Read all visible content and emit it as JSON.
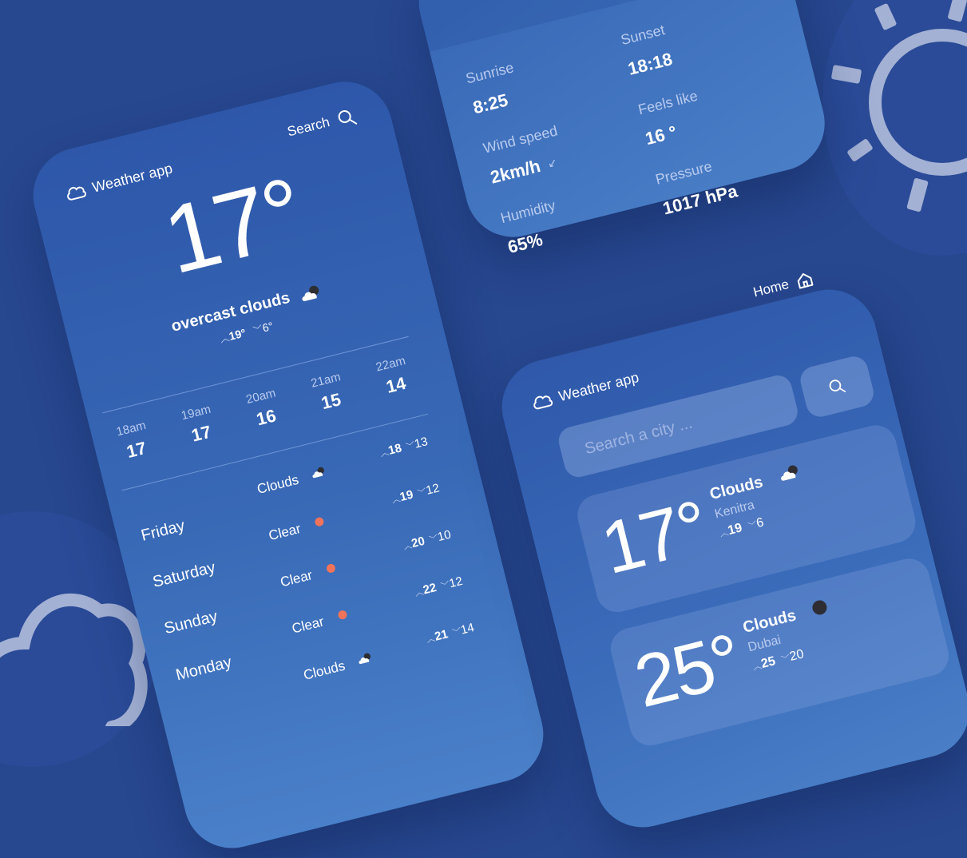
{
  "main": {
    "brand": "Weather app",
    "search_label": "Search",
    "temp": "17°",
    "condition": "overcast clouds",
    "high": "19°",
    "low": "6°",
    "hourly": [
      {
        "time": "18am",
        "temp": "17"
      },
      {
        "time": "19am",
        "temp": "17"
      },
      {
        "time": "20am",
        "temp": "16"
      },
      {
        "time": "21am",
        "temp": "15"
      },
      {
        "time": "22am",
        "temp": "14"
      }
    ],
    "daily": [
      {
        "day": "Friday",
        "condition": "Clouds",
        "icon": "cloud-sun-icon",
        "high": "18",
        "low": "13"
      },
      {
        "day": "Saturday",
        "condition": "Clear",
        "icon": "sun-dot-icon",
        "high": "19",
        "low": "12"
      },
      {
        "day": "Sunday",
        "condition": "Clear",
        "icon": "sun-dot-icon",
        "high": "20",
        "low": "10"
      },
      {
        "day": "Monday",
        "condition": "Clear",
        "icon": "sun-dot-icon",
        "high": "22",
        "low": "12"
      },
      {
        "day": "",
        "condition": "Clouds",
        "icon": "cloud-sun-icon",
        "high": "21",
        "low": "14"
      }
    ]
  },
  "details": {
    "sunrise_label": "Sunrise",
    "sunrise_value": "8:25",
    "sunset_label": "Sunset",
    "sunset_value": "18:18",
    "feels_label": "Feels like",
    "feels_value": "16 °",
    "wind_label": "Wind speed",
    "wind_value": "2km/h",
    "pressure_label": "Pressure",
    "pressure_value": "1017 hPa",
    "humidity_label": "Humidity",
    "humidity_value": "65%"
  },
  "search_screen": {
    "home_label": "Home",
    "brand": "Weather app",
    "placeholder": "Search a city ...",
    "cities": [
      {
        "temp": "17°",
        "condition": "Clouds",
        "city": "Kenitra",
        "high": "19",
        "low": "6"
      },
      {
        "temp": "25°",
        "condition": "Clouds",
        "city": "Dubai",
        "high": "25",
        "low": "20"
      }
    ]
  },
  "colors": {
    "background": "#27478f",
    "card_gradient_start": "#2e56a8",
    "card_gradient_end": "#4a80c9",
    "clear_dot": "#f0735a"
  }
}
